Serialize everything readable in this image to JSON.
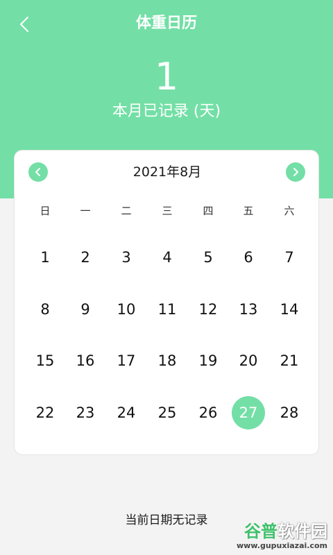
{
  "header": {
    "title": "体重日历",
    "record_count": "1",
    "record_label": "本月已记录 (天)"
  },
  "calendar": {
    "month_title": "2021年8月",
    "weekdays": [
      "日",
      "一",
      "二",
      "三",
      "四",
      "五",
      "六"
    ],
    "weeks": [
      [
        "1",
        "2",
        "3",
        "4",
        "5",
        "6",
        "7"
      ],
      [
        "8",
        "9",
        "10",
        "11",
        "12",
        "13",
        "14"
      ],
      [
        "15",
        "16",
        "17",
        "18",
        "19",
        "20",
        "21"
      ],
      [
        "22",
        "23",
        "24",
        "25",
        "26",
        "27",
        "28"
      ]
    ],
    "selected_day": "27"
  },
  "status": {
    "no_record_text": "当前日期无记录"
  },
  "watermark": {
    "logo_part1": "谷普",
    "logo_part2": "软件园",
    "url": "www.gupuxiazai.com"
  },
  "colors": {
    "accent": "#73dfa6",
    "background": "#f3f3f3",
    "card": "#ffffff"
  },
  "icons": {
    "back": "chevron-left-icon",
    "prev_month": "chevron-left-icon",
    "next_month": "chevron-right-icon"
  }
}
